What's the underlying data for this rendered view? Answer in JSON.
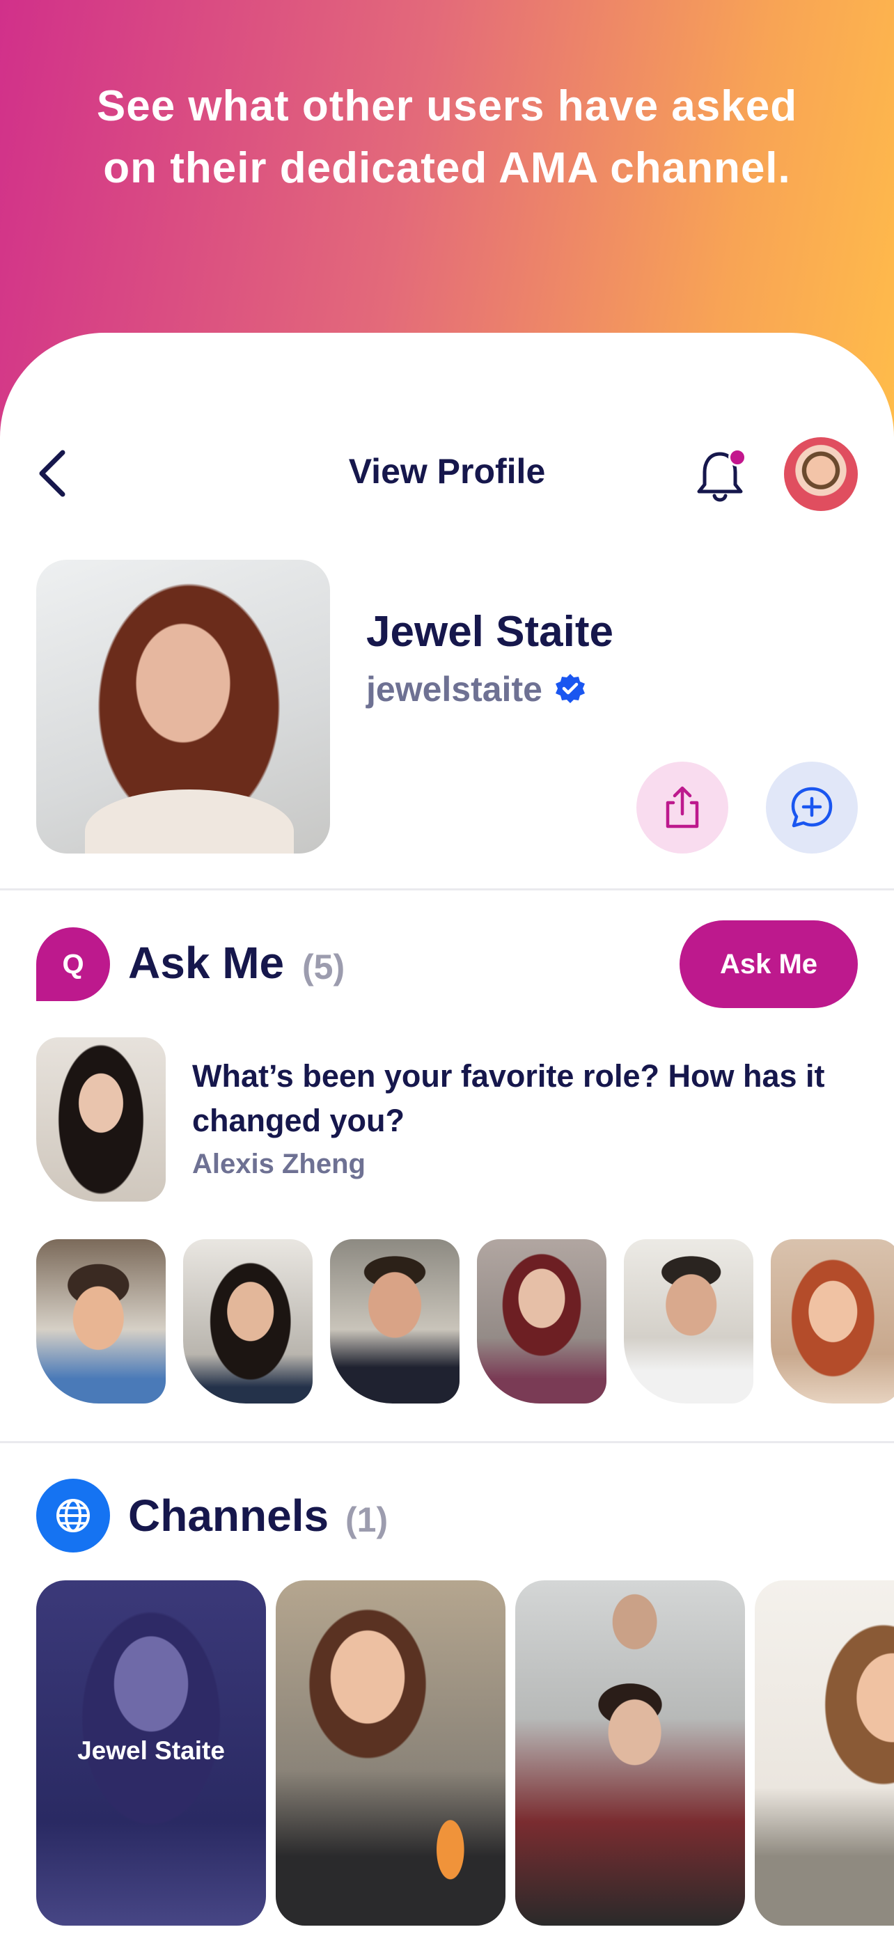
{
  "banner": {
    "headline": "See what other users have asked on their dedicated AMA channel."
  },
  "header": {
    "title": "View Profile"
  },
  "profile": {
    "name": "Jewel Staite",
    "handle": "jewelstaite"
  },
  "ask_me": {
    "icon_letter": "Q",
    "title": "Ask Me",
    "count": "(5)",
    "button_label": "Ask Me",
    "featured_question": {
      "text": "What’s been your favorite role? How has it changed you?",
      "author": "Alexis Zheng"
    }
  },
  "channels": {
    "title": "Channels",
    "count": "(1)",
    "cards": [
      {
        "label": "Jewel Staite"
      }
    ]
  },
  "colors": {
    "brand_magenta": "#bd198d",
    "channel_blue": "#1573f2",
    "text_navy": "#16174c",
    "text_muted": "#6e7193"
  }
}
